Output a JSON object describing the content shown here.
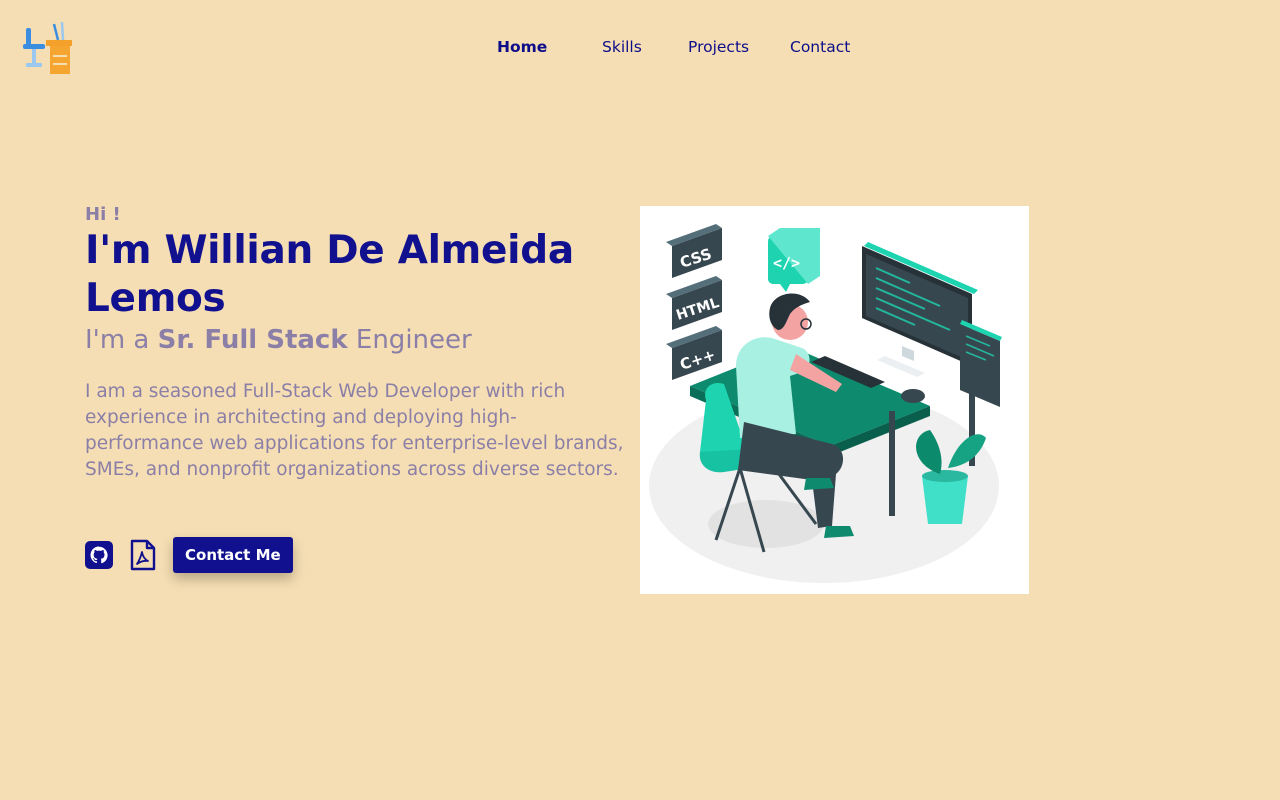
{
  "nav": {
    "items": [
      {
        "label": "Home",
        "active": true
      },
      {
        "label": "Skills",
        "active": false
      },
      {
        "label": "Projects",
        "active": false
      },
      {
        "label": "Contact",
        "active": false
      }
    ]
  },
  "hero": {
    "greeting": "Hi !",
    "name": "I'm Willian De Almeida Lemos",
    "role_prefix": "I'm a ",
    "role_highlight": "Sr. Full Stack",
    "role_suffix": " Engineer",
    "bio": "I am a seasoned Full-Stack Web Developer with rich experience in architecting and deploying high-performance web applications for enterprise-level brands, SMEs, and nonprofit organizations across diverse sectors.",
    "contact_button": "Contact Me"
  },
  "illustration": {
    "badges": [
      "CSS",
      "HTML",
      "C++"
    ],
    "code_bubble": "</>"
  },
  "icons": {
    "logo": "desk-chair-logo-icon",
    "github": "github-icon",
    "resume": "pdf-file-icon"
  },
  "colors": {
    "background": "#f5deb3",
    "primary": "#11118f",
    "muted": "#8b7fa8",
    "accent": "#1dd3b0"
  }
}
